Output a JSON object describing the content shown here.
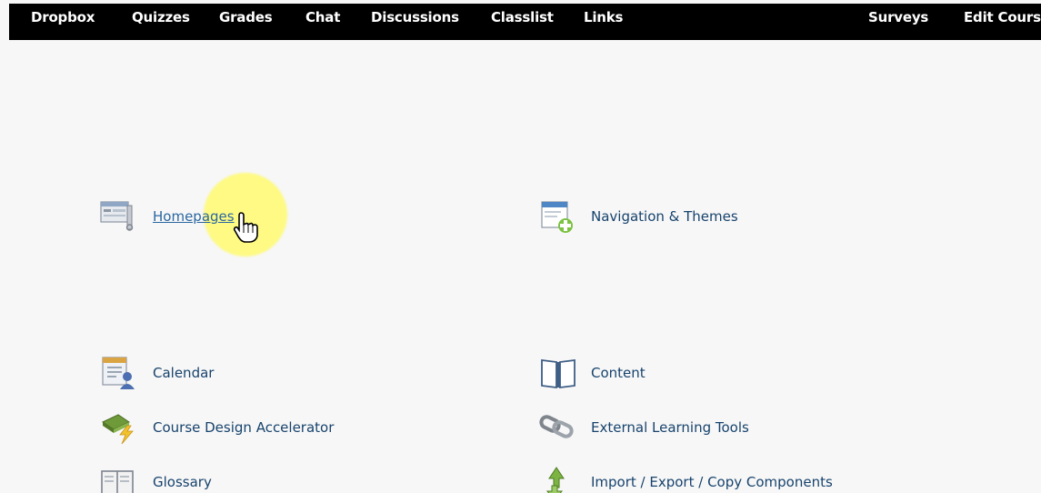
{
  "nav": {
    "items": [
      {
        "label": "Dropbox"
      },
      {
        "label": "Quizzes"
      },
      {
        "label": "Grades"
      },
      {
        "label": "Chat"
      },
      {
        "label": "Discussions"
      },
      {
        "label": "Classlist"
      },
      {
        "label": "Links"
      },
      {
        "label": "Surveys"
      },
      {
        "label": "Edit Cours"
      }
    ]
  },
  "tools": {
    "homepages": {
      "label": "Homepages",
      "icon": "homepages-icon"
    },
    "navigation_themes": {
      "label": "Navigation & Themes",
      "icon": "navigation-themes-icon"
    },
    "calendar": {
      "label": "Calendar",
      "icon": "calendar-icon"
    },
    "content": {
      "label": "Content",
      "icon": "book-icon"
    },
    "course_design_accelerator": {
      "label": "Course Design Accelerator",
      "icon": "lightning-icon"
    },
    "external_learning_tools": {
      "label": "External Learning Tools",
      "icon": "chain-link-icon"
    },
    "glossary": {
      "label": "Glossary",
      "icon": "glossary-icon"
    },
    "import_export": {
      "label": "Import / Export / Copy Components",
      "icon": "recycle-arrows-icon"
    }
  },
  "colors": {
    "nav_bg": "#000000",
    "nav_text": "#ffffff",
    "link": "#17436d",
    "highlight": "#fff86e"
  }
}
